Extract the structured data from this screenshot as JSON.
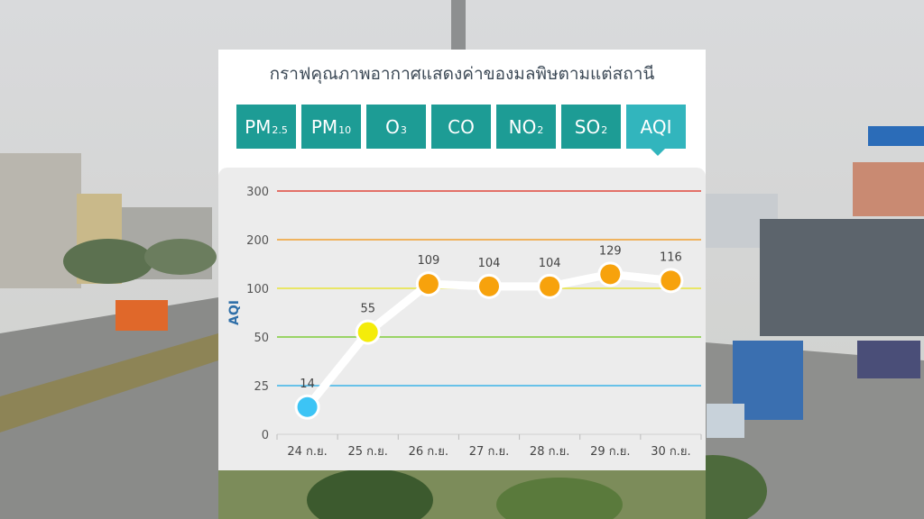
{
  "title": "กราฟคุณภาพอากาศแสดงค่าของมลพิษตามแต่สถานี",
  "tabs": [
    {
      "label": "PM",
      "sub": "2.5",
      "active": false
    },
    {
      "label": "PM",
      "sub": "10",
      "active": false
    },
    {
      "label": "O",
      "sub": "3",
      "active": false
    },
    {
      "label": "CO",
      "sub": "",
      "active": false
    },
    {
      "label": "NO",
      "sub": "2",
      "active": false
    },
    {
      "label": "SO",
      "sub": "2",
      "active": false
    },
    {
      "label": "AQI",
      "sub": "",
      "active": true
    }
  ],
  "colors": {
    "tab": "#1d9c95",
    "tab_active": "#32b5bd",
    "chart_bg": "#ececec"
  },
  "chart_data": {
    "type": "line",
    "ylabel": "AQI",
    "categories": [
      "24 ก.ย.",
      "25 ก.ย.",
      "26 ก.ย.",
      "27 ก.ย.",
      "28 ก.ย.",
      "29 ก.ย.",
      "30 ก.ย."
    ],
    "values": [
      14,
      55,
      109,
      104,
      104,
      129,
      116
    ],
    "point_colors": [
      "#3cc4f5",
      "#f4ec0a",
      "#f7a20c",
      "#f7a20c",
      "#f7a20c",
      "#f7a20c",
      "#f7a20c"
    ],
    "yticks": [
      "0",
      "25",
      "50",
      "100",
      "200",
      "300"
    ],
    "threshold_lines": [
      {
        "value": 25,
        "color": "#3cb4e8"
      },
      {
        "value": 50,
        "color": "#7fcc3a"
      },
      {
        "value": 100,
        "color": "#e8e43a"
      },
      {
        "value": 200,
        "color": "#f0a030"
      },
      {
        "value": 300,
        "color": "#e0463c"
      }
    ],
    "line_color": "#ffffff",
    "axis_scale": "piecewise"
  }
}
